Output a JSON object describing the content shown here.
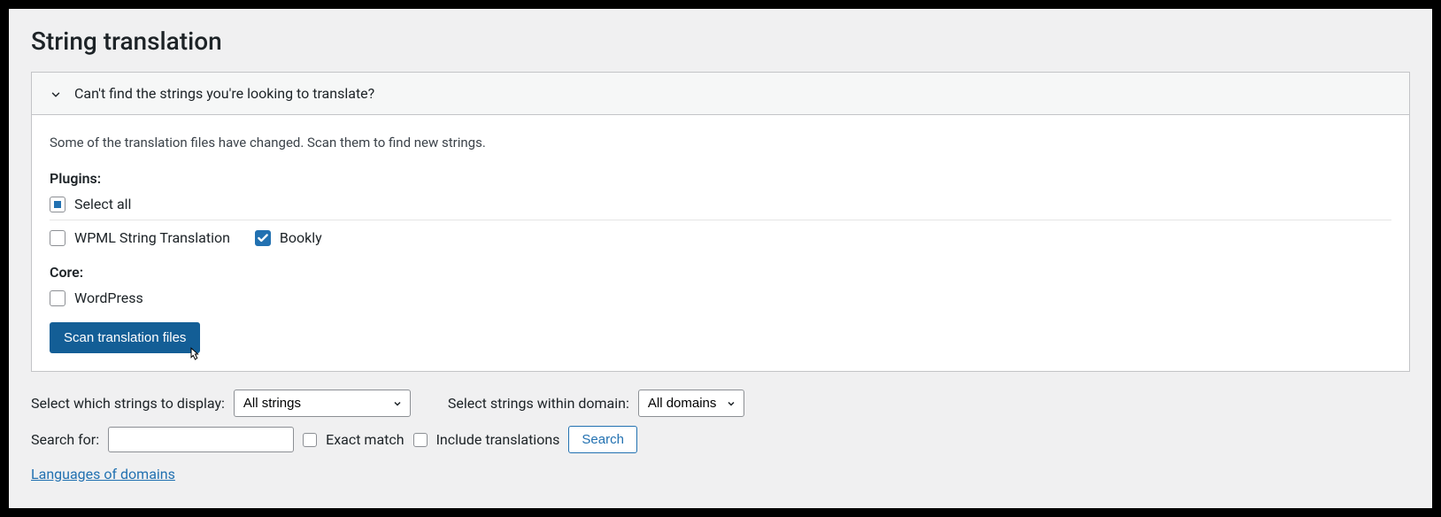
{
  "page_title": "String translation",
  "panel": {
    "header": "Can't find the strings you're looking to translate?",
    "info": "Some of the translation files have changed. Scan them to find new strings.",
    "plugins_label": "Plugins:",
    "select_all": "Select all",
    "plugin_items": [
      {
        "label": "WPML String Translation",
        "checked": false
      },
      {
        "label": "Bookly",
        "checked": true
      }
    ],
    "core_label": "Core:",
    "core_items": [
      {
        "label": "WordPress",
        "checked": false
      }
    ],
    "scan_button": "Scan translation files"
  },
  "filters": {
    "display_label": "Select which strings to display:",
    "display_value": "All strings",
    "domain_label": "Select strings within domain:",
    "domain_value": "All domains",
    "search_label": "Search for:",
    "search_value": "",
    "exact_match": "Exact match",
    "include_translations": "Include translations",
    "search_button": "Search",
    "languages_link": "Languages of domains"
  }
}
